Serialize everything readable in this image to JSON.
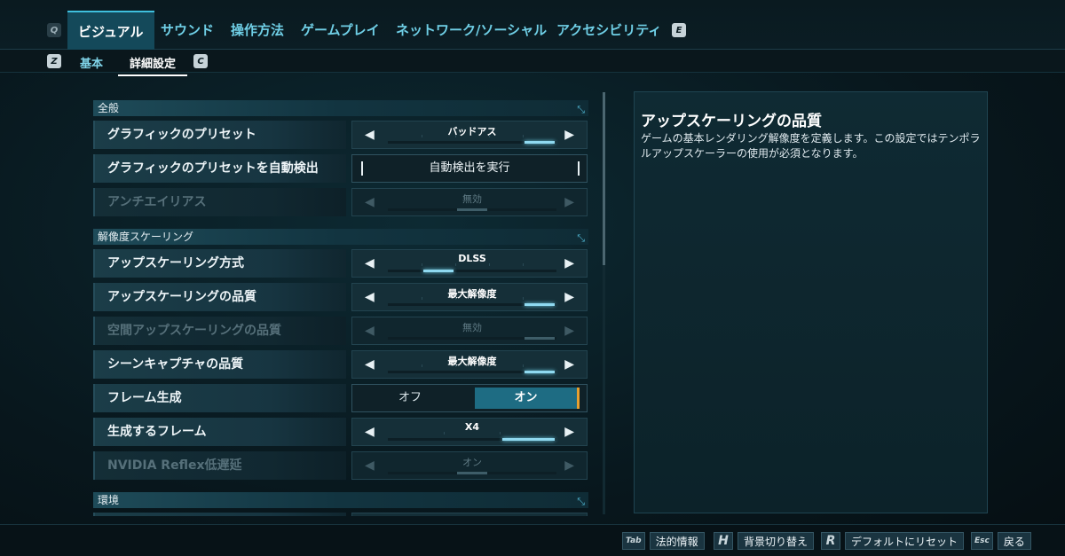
{
  "top_tabs": {
    "left_key": "Q",
    "right_key": "E",
    "items": [
      {
        "label": "ビジュアル",
        "active": true
      },
      {
        "label": "サウンド"
      },
      {
        "label": "操作方法"
      },
      {
        "label": "ゲームプレイ"
      },
      {
        "label": "ネットワーク/ソーシャル"
      },
      {
        "label": "アクセシビリティ"
      }
    ]
  },
  "sub_tabs": {
    "left_key": "Z",
    "right_key": "C",
    "items": [
      {
        "label": "基本"
      },
      {
        "label": "詳細設定",
        "active": true
      }
    ]
  },
  "sections": {
    "general": "全般",
    "resolution_scaling": "解像度スケーリング",
    "environment": "環境"
  },
  "settings": {
    "graphics_preset": {
      "label": "グラフィックのプリセット",
      "value": "バッドアス",
      "level": 0.95
    },
    "auto_detect": {
      "label": "グラフィックのプリセットを自動検出",
      "button": "自動検出を実行"
    },
    "anti_aliasing": {
      "label": "アンチエイリアス",
      "value": "無効",
      "level": 0.5
    },
    "upscaling_method": {
      "label": "アップスケーリング方式",
      "value": "DLSS",
      "level": 0.3
    },
    "upscaling_quality": {
      "label": "アップスケーリングの品質",
      "value": "最大解像度",
      "level": 1.0
    },
    "spatial_upscaling_quality": {
      "label": "空間アップスケーリングの品質",
      "value": "無効",
      "level": 1.0
    },
    "scene_capture_quality": {
      "label": "シーンキャプチャの品質",
      "value": "最大解像度",
      "level": 1.0
    },
    "frame_generation": {
      "label": "フレーム生成",
      "off": "オフ",
      "on": "オン"
    },
    "generated_frames": {
      "label": "生成するフレーム",
      "value": "X4",
      "level": 1.0
    },
    "nvidia_reflex": {
      "label": "NVIDIA Reflex低遅延",
      "value": "オン",
      "level": 0.5
    }
  },
  "description": {
    "title": "アップスケーリングの品質",
    "text": "ゲームの基本レンダリング解像度を定義します。この設定ではテンポラルアップスケーラーの使用が必須となります。"
  },
  "bottom_hints": [
    {
      "key": "Tab",
      "label": "法的情報"
    },
    {
      "key": "H",
      "label": "背景切り替え"
    },
    {
      "key": "R",
      "label": "デフォルトにリセット"
    },
    {
      "key": "Esc",
      "label": "戻る"
    }
  ]
}
